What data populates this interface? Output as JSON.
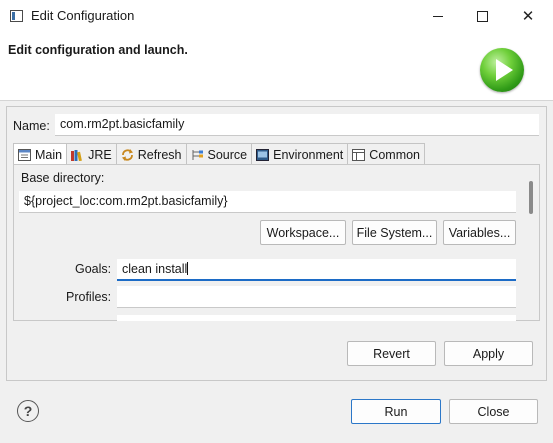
{
  "window": {
    "title": "Edit Configuration",
    "icon": "eclipse-window-icon",
    "controls": {
      "minimize": "minimize-icon",
      "maximize": "maximize-icon",
      "close": "✕"
    }
  },
  "header": {
    "heading": "Edit configuration and launch.",
    "icon": "launch-run-icon"
  },
  "name": {
    "label": "Name:",
    "value": "com.rm2pt.basicfamily"
  },
  "tabs": [
    {
      "label": "Main",
      "icon": "main-tab-icon",
      "active": true
    },
    {
      "label": "JRE",
      "icon": "jre-books-icon",
      "active": false
    },
    {
      "label": "Refresh",
      "icon": "refresh-icon",
      "active": false
    },
    {
      "label": "Source",
      "icon": "source-icon",
      "active": false
    },
    {
      "label": "Environment",
      "icon": "environment-icon",
      "active": false
    },
    {
      "label": "Common",
      "icon": "common-icon",
      "active": false
    }
  ],
  "main": {
    "base_directory_label": "Base directory:",
    "base_directory_value": "${project_loc:com.rm2pt.basicfamily}",
    "buttons": {
      "workspace": "Workspace...",
      "file_system": "File System...",
      "variables": "Variables..."
    },
    "goals_label": "Goals:",
    "goals_value": "clean install",
    "profiles_label": "Profiles:",
    "profiles_value": ""
  },
  "actions": {
    "revert": "Revert",
    "apply": "Apply",
    "run": "Run",
    "close": "Close"
  },
  "help": {
    "symbol": "?"
  },
  "colors": {
    "accent": "#1c6bc6",
    "launch_green": "#3aa81e"
  }
}
